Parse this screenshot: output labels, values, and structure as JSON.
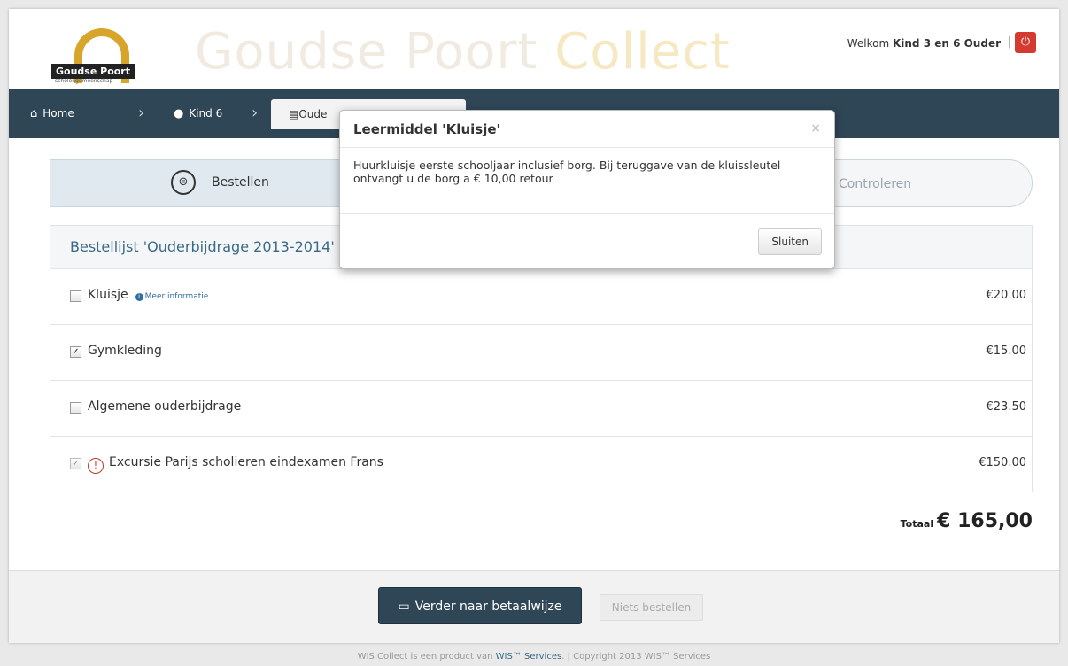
{
  "header": {
    "logo_text": "Goudse Poort",
    "logo_subtext": "scholengemeenschap",
    "brand_part1": "Goudse Poort ",
    "brand_part2": "Collect",
    "welcome_prefix": "Welkom ",
    "welcome_user": "Kind 3 en 6 Ouder",
    "separator": "|",
    "power_icon": "power-icon",
    "colors": {
      "brand_gold": "#d7a529",
      "power_red": "#d43a2f"
    }
  },
  "nav": {
    "background": "#2f4656",
    "items": [
      {
        "label": "Home",
        "icon": "home-icon"
      },
      {
        "label": "Kind 6",
        "icon": "user-icon"
      },
      {
        "label": "Oude",
        "icon": "list-icon"
      }
    ]
  },
  "steps": [
    {
      "label": "Bestellen",
      "icon": "cart-icon"
    },
    {
      "label": "Controleren"
    }
  ],
  "order_list": {
    "title": "Bestellijst 'Ouderbijdrage 2013-2014'",
    "items": [
      {
        "label": "Kluisje",
        "price": "€20.00",
        "checked": false,
        "more_info": "Meer informatie"
      },
      {
        "label": "Gymkleding",
        "price": "€15.00",
        "checked": true
      },
      {
        "label": "Algemene ouderbijdrage",
        "price": "€23.50",
        "checked": false
      },
      {
        "label": "Excursie Parijs scholieren eindexamen Frans",
        "price": "€150.00",
        "checked": true,
        "disabled": true,
        "warning": true
      }
    ],
    "total_label": "Totaal",
    "total_value": "€ 165,00"
  },
  "footer": {
    "primary_button": "Verder naar betaalwijze",
    "secondary_button": "Niets bestellen",
    "copyright_prefix": "WIS Collect is een product van ",
    "copyright_link": "WIS™ Services",
    "copyright_suffix": ". | Copyright 2013 WIS™ Services"
  },
  "modal": {
    "title": "Leermiddel 'Kluisje'",
    "close_symbol": "×",
    "body": "Huurkluisje eerste schooljaar inclusief borg. Bij teruggave van de kluissleutel ontvangt u de borg a € 10,00 retour",
    "close_button": "Sluiten"
  }
}
